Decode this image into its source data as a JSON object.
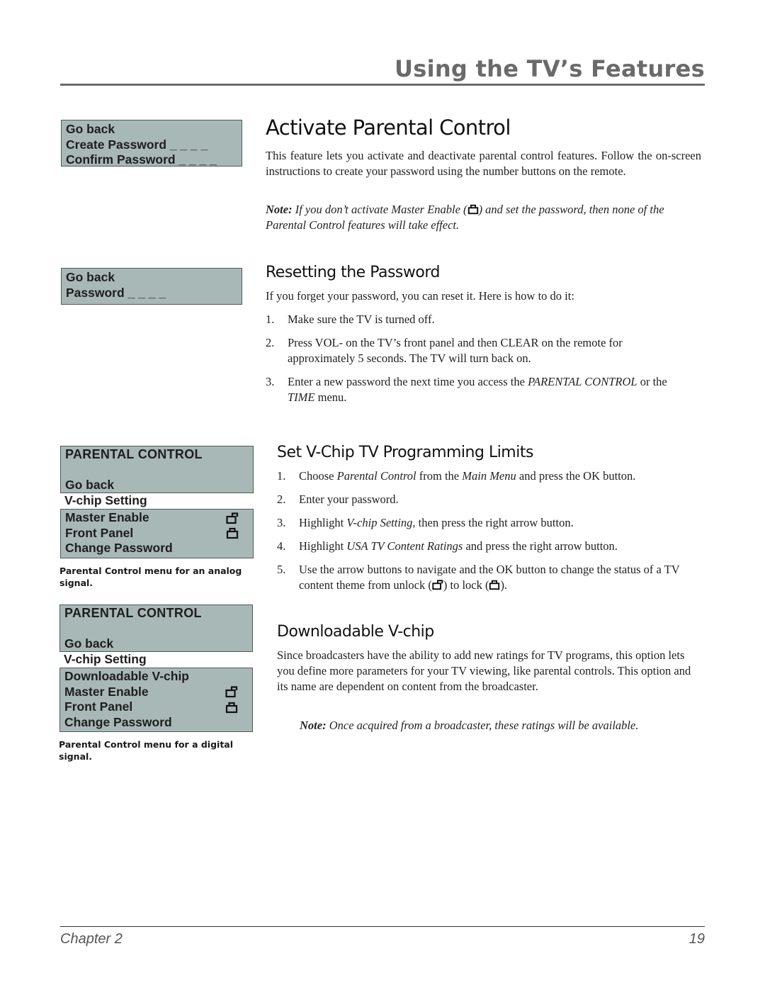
{
  "header": {
    "title": "Using the TV’s Features"
  },
  "menus": {
    "create_password": {
      "items": [
        "Go back",
        "Create Password _ _ _ _",
        "Confirm Password _ _ _ _"
      ]
    },
    "enter_password": {
      "items": [
        "Go back",
        "Password _ _ _ _"
      ]
    },
    "analog": {
      "title": "PARENTAL CONTROL",
      "go_back": "Go back",
      "selected": "V-chip Setting",
      "items": [
        {
          "label": "Master Enable",
          "icon": "unlock-icon"
        },
        {
          "label": "Front Panel",
          "icon": "lock-icon"
        },
        {
          "label": "Change Password",
          "icon": ""
        }
      ],
      "caption": "Parental Control menu for an analog signal."
    },
    "digital": {
      "title": "PARENTAL CONTROL",
      "go_back": "Go back",
      "selected": "V-chip Setting",
      "items": [
        {
          "label": "Downloadable V-chip",
          "icon": ""
        },
        {
          "label": "Master Enable",
          "icon": "unlock-icon"
        },
        {
          "label": "Front Panel",
          "icon": "lock-icon"
        },
        {
          "label": "Change Password",
          "icon": ""
        }
      ],
      "caption": "Parental Control menu for a digital signal."
    }
  },
  "sections": {
    "activate": {
      "heading": "Activate Parental Control",
      "body": "This feature lets you activate and deactivate parental control features. Follow the on-screen instructions to create your password using the number buttons on the remote.",
      "note_label": "Note:",
      "note_pre": " If you don’t activate Master Enable (",
      "note_post": ") and set the password, then none of the Parental Control features will take effect."
    },
    "reset": {
      "heading": "Resetting the Password",
      "intro": "If you forget your password, you can reset it. Here is how to do it:",
      "steps": [
        {
          "num": "1.",
          "text": "Make sure the TV is turned off."
        },
        {
          "num": "2.",
          "text": "Press VOL- on the TV’s front panel and then CLEAR on the remote for approximately 5 seconds. The TV will turn back on."
        },
        {
          "num": "3.",
          "pre": "Enter a new password the next time you access the ",
          "em1": "PARENTAL CONTROL",
          "mid": " or the ",
          "em2": "TIME",
          "post": " menu."
        }
      ]
    },
    "vchip": {
      "heading": "Set V-Chip TV Programming Limits",
      "steps": [
        {
          "num": "1.",
          "pre": "Choose ",
          "em1": "Parental Control",
          "mid": " from the ",
          "em2": "Main Menu",
          "post": " and press the OK button."
        },
        {
          "num": "2.",
          "text": "Enter your password."
        },
        {
          "num": "3.",
          "pre": "Highlight ",
          "em1": "V-chip Setting",
          "post": ", then press the right arrow button."
        },
        {
          "num": "4.",
          "pre": "Highlight ",
          "em1": "USA TV Content Ratings",
          "post": " and press the right arrow button."
        },
        {
          "num": "5.",
          "pre": "Use the arrow buttons to navigate and the OK button to change the status of a TV content theme from unlock (",
          "mid": ") to lock (",
          "post": ")."
        }
      ]
    },
    "downloadable": {
      "heading": "Downloadable V-chip",
      "body": "Since broadcasters have the ability to add new ratings for TV programs, this option lets you define more parameters for your TV viewing, like parental controls. This option and its name are dependent on content from the broadcaster.",
      "note_label": "Note:",
      "note_text": " Once acquired from a broadcaster, these ratings will be available."
    }
  },
  "footer": {
    "chapter": "Chapter 2",
    "page": "19"
  },
  "colors": {
    "menu_bg": "#a8b8b6",
    "header_gray": "#6a6a6a"
  }
}
